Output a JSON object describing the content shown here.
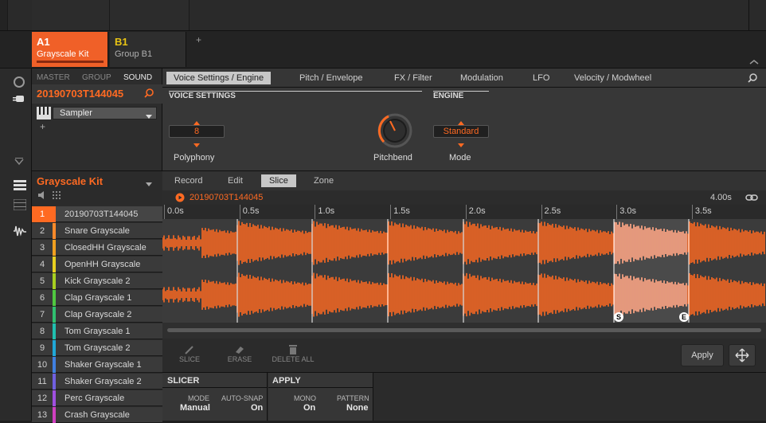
{
  "groups": {
    "add_label": "+",
    "items": [
      {
        "id": "A1",
        "name": "Grayscale Kit",
        "color": "#ff6a22",
        "selected": true
      },
      {
        "id": "B1",
        "name": "Group B1",
        "color": "#e8c414",
        "selected": false
      }
    ]
  },
  "sound_panel": {
    "tabs": [
      "MASTER",
      "GROUP",
      "SOUND"
    ],
    "selected_tab": "SOUND",
    "sound_name": "20190703T144045",
    "plugin": "Sampler",
    "add_label": "+"
  },
  "param_tabs": {
    "items": [
      "Voice Settings / Engine",
      "Pitch / Envelope",
      "FX / Filter",
      "Modulation",
      "LFO",
      "Velocity / Modwheel"
    ],
    "selected": 0
  },
  "params": {
    "section_voice": "VOICE SETTINGS",
    "section_engine": "ENGINE",
    "polyphony_value": "8",
    "polyphony_label": "Polyphony",
    "pitchbend_label": "Pitchbend",
    "mode_value": "Standard",
    "mode_label": "Mode"
  },
  "kit": {
    "name": "Grayscale Kit",
    "slots": [
      {
        "num": "1",
        "name": "20190703T144045",
        "color": "#ff6a22"
      },
      {
        "num": "2",
        "name": "Snare Grayscale",
        "color": "#ff8a2a"
      },
      {
        "num": "3",
        "name": "ClosedHH Grayscale",
        "color": "#f0a020"
      },
      {
        "num": "4",
        "name": "OpenHH Grayscale",
        "color": "#e8d020"
      },
      {
        "num": "5",
        "name": "Kick Grayscale 2",
        "color": "#a8d020"
      },
      {
        "num": "6",
        "name": "Clap Grayscale 1",
        "color": "#50c840"
      },
      {
        "num": "7",
        "name": "Clap Grayscale 2",
        "color": "#30c070"
      },
      {
        "num": "8",
        "name": "Tom Grayscale 1",
        "color": "#20c0b0"
      },
      {
        "num": "9",
        "name": "Tom Grayscale 2",
        "color": "#20a8d8"
      },
      {
        "num": "10",
        "name": "Shaker Grayscale 1",
        "color": "#4080e0"
      },
      {
        "num": "11",
        "name": "Shaker Grayscale 2",
        "color": "#7060e0"
      },
      {
        "num": "12",
        "name": "Perc Grayscale",
        "color": "#a050e0"
      },
      {
        "num": "13",
        "name": "Crash Grayscale",
        "color": "#d040c0"
      }
    ]
  },
  "editor": {
    "tabs": [
      "Record",
      "Edit",
      "Slice",
      "Zone"
    ],
    "selected_tab": "Slice",
    "sample_name": "20190703T144045",
    "length": "4.00s",
    "ruler": [
      "0.0s",
      "0.5s",
      "1.0s",
      "1.5s",
      "2.0s",
      "2.5s",
      "3.0s",
      "3.5s"
    ],
    "slice_start_marker": "S",
    "slice_end_marker": "E",
    "tools": [
      "SLICE",
      "ERASE",
      "DELETE ALL"
    ],
    "apply_label": "Apply"
  },
  "slicer": {
    "title": "SLICER",
    "mode_label": "MODE",
    "mode_value": "Manual",
    "autosnap_label": "AUTO-SNAP",
    "autosnap_value": "On"
  },
  "apply_section": {
    "title": "APPLY",
    "mono_label": "MONO",
    "mono_value": "On",
    "pattern_label": "PATTERN",
    "pattern_value": "None"
  },
  "colors": {
    "accent": "#ff6a22",
    "waveform": "#ff6a22",
    "selected_slice_wave": "#f0a890"
  }
}
